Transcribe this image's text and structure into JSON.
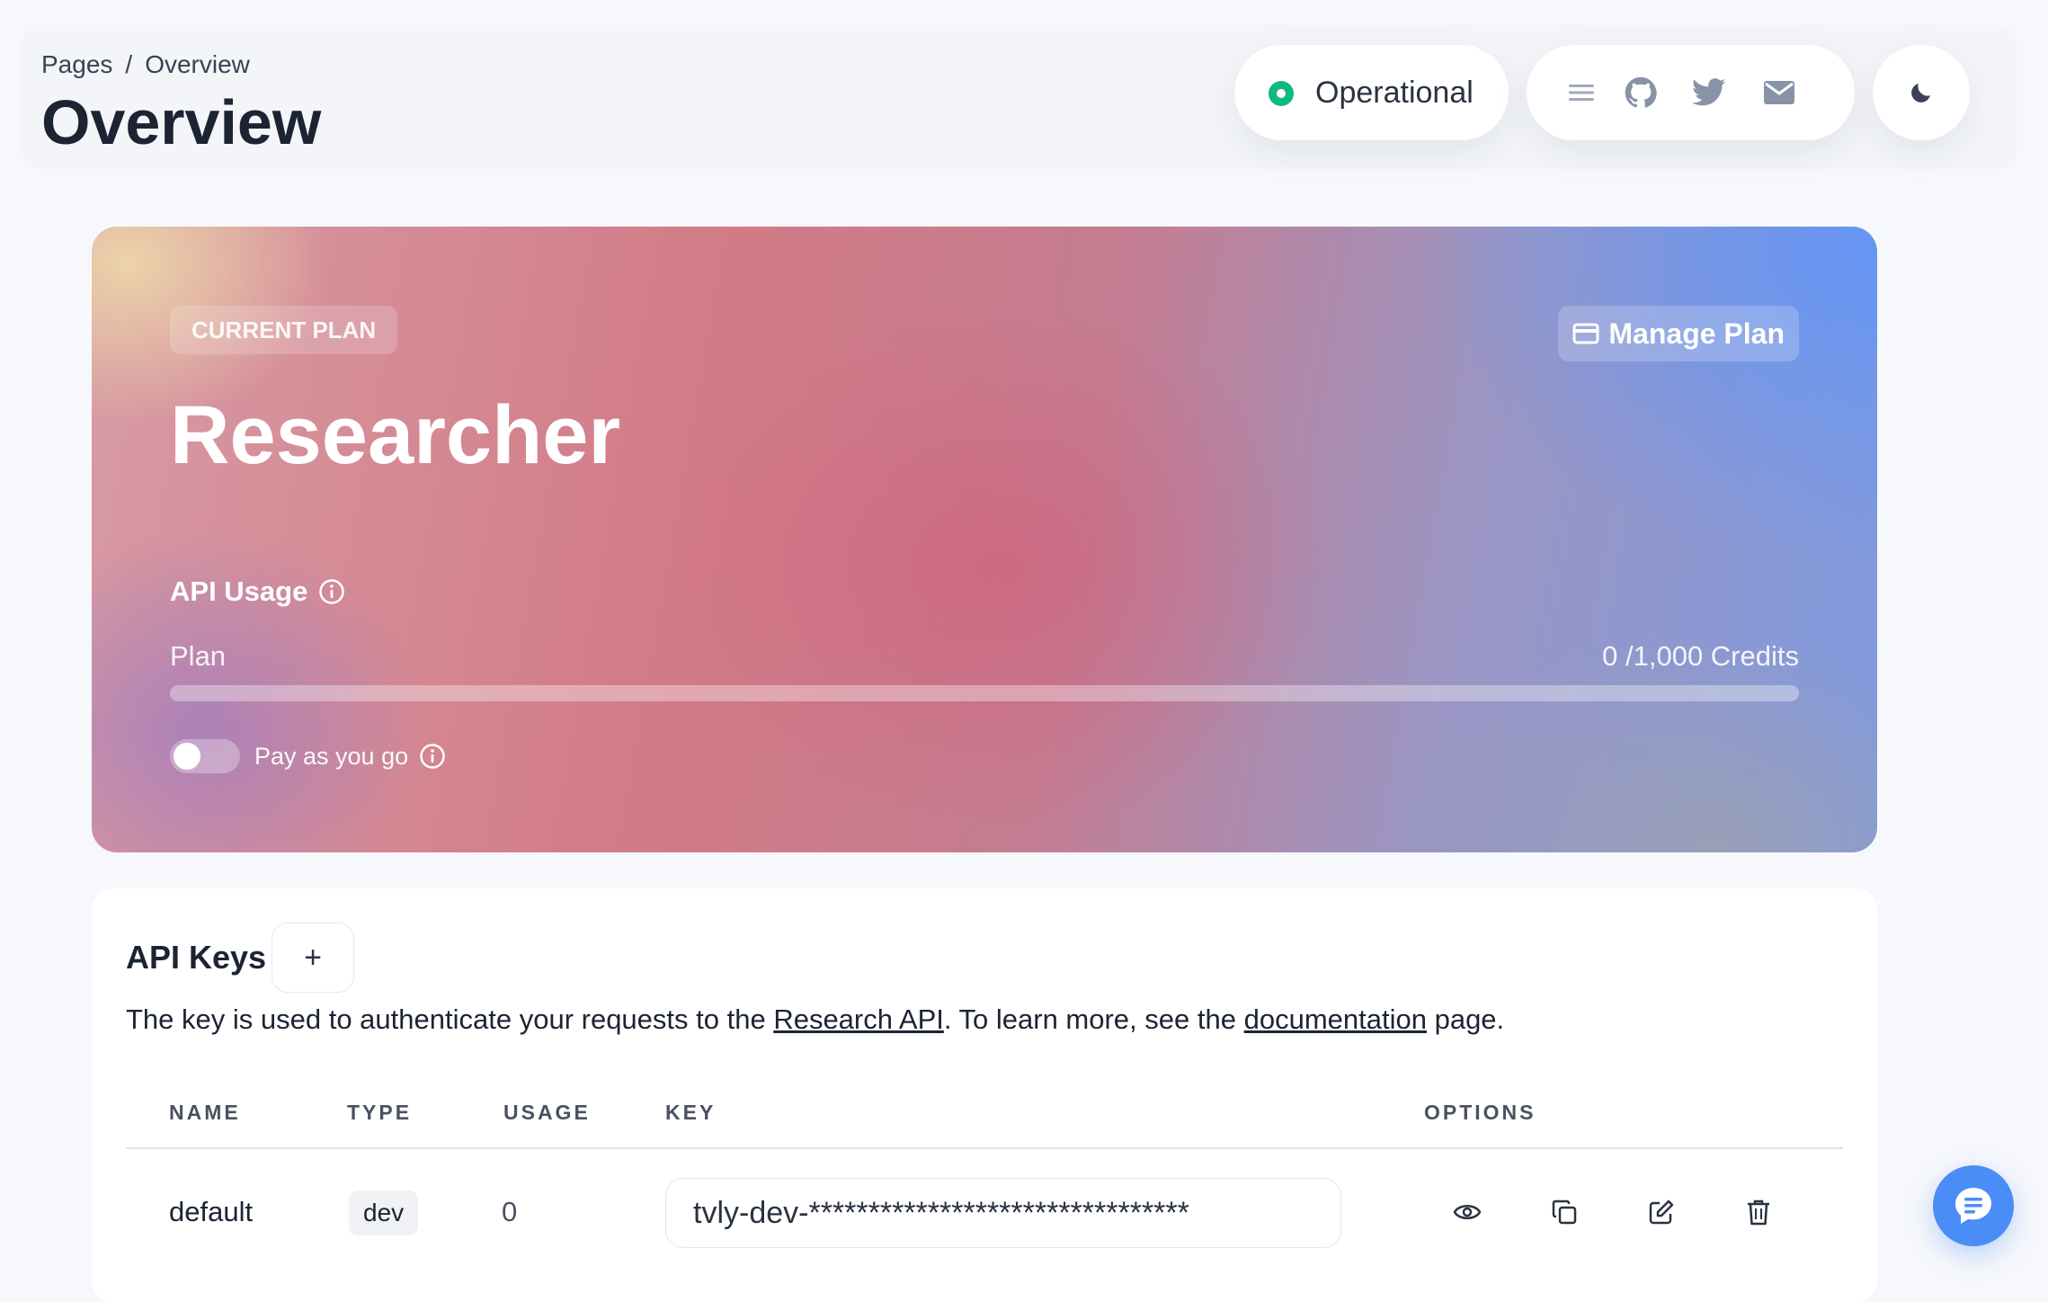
{
  "breadcrumb": {
    "root": "Pages",
    "separator": "/",
    "current": "Overview"
  },
  "page_title": "Overview",
  "status": {
    "label": "Operational",
    "color": "#10b981"
  },
  "header_icons": [
    "menu-icon",
    "github-icon",
    "twitter-icon",
    "mail-icon",
    "moon-icon"
  ],
  "plan": {
    "badge": "CURRENT PLAN",
    "name": "Researcher",
    "manage_label": "Manage Plan",
    "usage_heading": "API Usage",
    "row_label": "Plan",
    "credits_text": "0 /1,000 Credits",
    "credits_used": 0,
    "credits_total": 1000,
    "payg_label": "Pay as you go",
    "payg_enabled": false
  },
  "api_keys": {
    "title": "API Keys",
    "add_label": "+",
    "description_prefix": "The key is used to authenticate your requests to the ",
    "research_api_link": "Research API",
    "description_middle": ". To learn more, see the ",
    "documentation_link": "documentation",
    "description_suffix": " page.",
    "columns": [
      "NAME",
      "TYPE",
      "USAGE",
      "KEY",
      "OPTIONS"
    ],
    "rows": [
      {
        "name": "default",
        "type": "dev",
        "usage": "0",
        "key": "tvly-dev-********************************"
      }
    ]
  },
  "accent_color": "#4a8df6"
}
